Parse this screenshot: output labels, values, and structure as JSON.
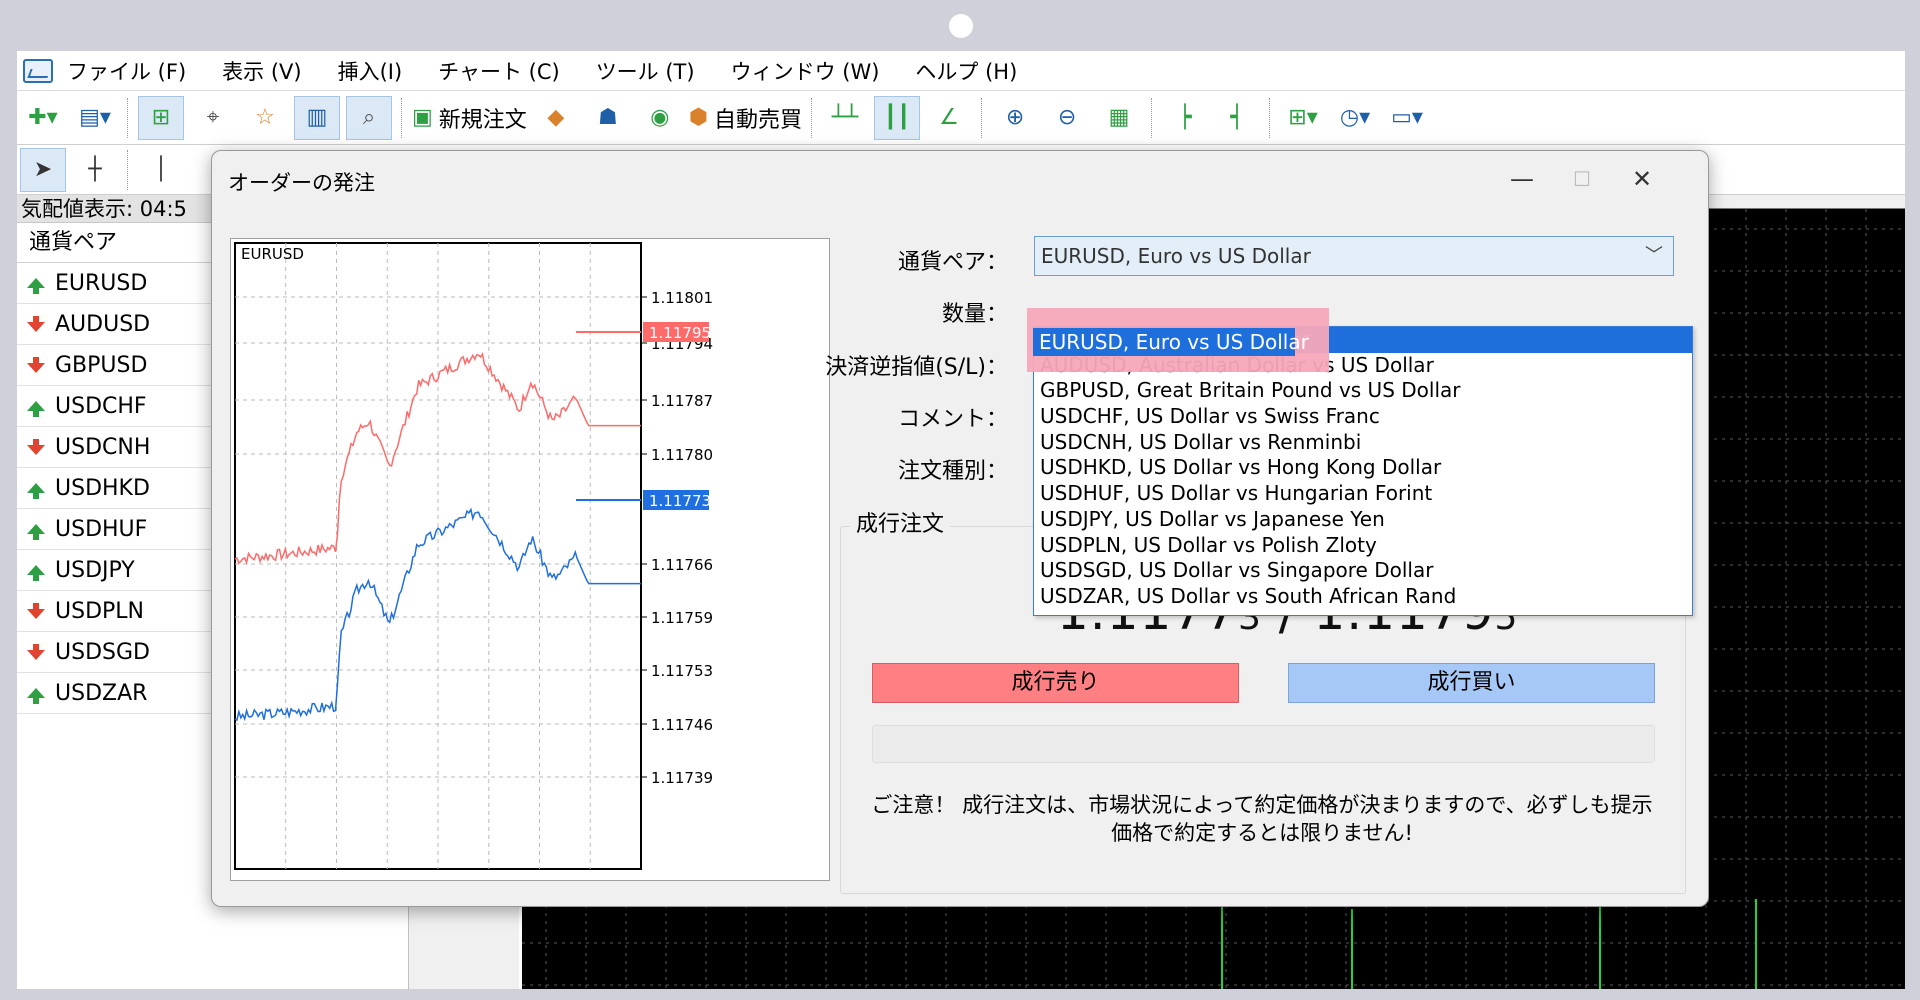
{
  "menu": [
    "ファイル (F)",
    "表示 (V)",
    "挿入(I)",
    "チャート (C)",
    "ツール (T)",
    "ウィンドウ (W)",
    "ヘルプ (H)"
  ],
  "toolbar": {
    "new_order_label": "新規注文",
    "auto_trade_label": "自動売買"
  },
  "market_watch": {
    "title": "気配値表示: 04:5",
    "column_header": "通貨ペア",
    "symbols": [
      {
        "name": "EURUSD",
        "dir": "up"
      },
      {
        "name": "AUDUSD",
        "dir": "down"
      },
      {
        "name": "GBPUSD",
        "dir": "down"
      },
      {
        "name": "USDCHF",
        "dir": "up"
      },
      {
        "name": "USDCNH",
        "dir": "down"
      },
      {
        "name": "USDHKD",
        "dir": "up"
      },
      {
        "name": "USDHUF",
        "dir": "up"
      },
      {
        "name": "USDJPY",
        "dir": "up"
      },
      {
        "name": "USDPLN",
        "dir": "down"
      },
      {
        "name": "USDSGD",
        "dir": "down"
      },
      {
        "name": "USDZAR",
        "dir": "up"
      }
    ]
  },
  "dialog": {
    "title": "オーダーの発注",
    "minimize": "—",
    "maximize": "☐",
    "close": "✕",
    "labels": {
      "symbol": "通貨ペア：",
      "volume": "数量：",
      "stop_loss": "決済逆指値(S/L)：",
      "comment": "コメント：",
      "order_type": "注文種別："
    },
    "symbol_value": "EURUSD, Euro vs US Dollar",
    "group_title": "成行注文",
    "price": {
      "bid_main": "1.1177",
      "bid_tail": "3",
      "separator": " / ",
      "ask_main": "1.1179",
      "ask_tail": "5"
    },
    "sell_button": "成行売り",
    "buy_button": "成行買い",
    "notice_line1": "ご注意！ 成行注文は、市場状況によって約定価格が決まりますので、必ずしも提示",
    "notice_line2": "価格で約定するとは限りません!"
  },
  "dropdown": {
    "selected": "EURUSD, Euro vs US Dollar",
    "items": [
      "EURUSD, Euro vs US Dollar",
      "AUDUSD, Australian Dollar vs US Dollar",
      "GBPUSD, Great Britain Pound vs US Dollar",
      "USDCHF, US Dollar vs Swiss Franc",
      "USDCNH, US Dollar vs Renminbi",
      "USDHKD, US Dollar vs Hong Kong Dollar",
      "USDHUF, US Dollar vs Hungarian Forint",
      "USDJPY, US Dollar vs Japanese Yen",
      "USDPLN, US Dollar vs Polish Zloty",
      "USDSGD, US Dollar vs Singapore Dollar",
      "USDZAR, US Dollar vs South African Rand"
    ]
  },
  "mini_chart": {
    "symbol": "EURUSD",
    "y_ticks": [
      "1.11801",
      "1.11794",
      "1.11787",
      "1.11780",
      "1.11766",
      "1.11759",
      "1.11753",
      "1.11746",
      "1.11739"
    ],
    "ask_label": "1.11795",
    "bid_label": "1.11773",
    "ask_color": "#ff6a6a",
    "bid_color": "#1f6fe0"
  }
}
